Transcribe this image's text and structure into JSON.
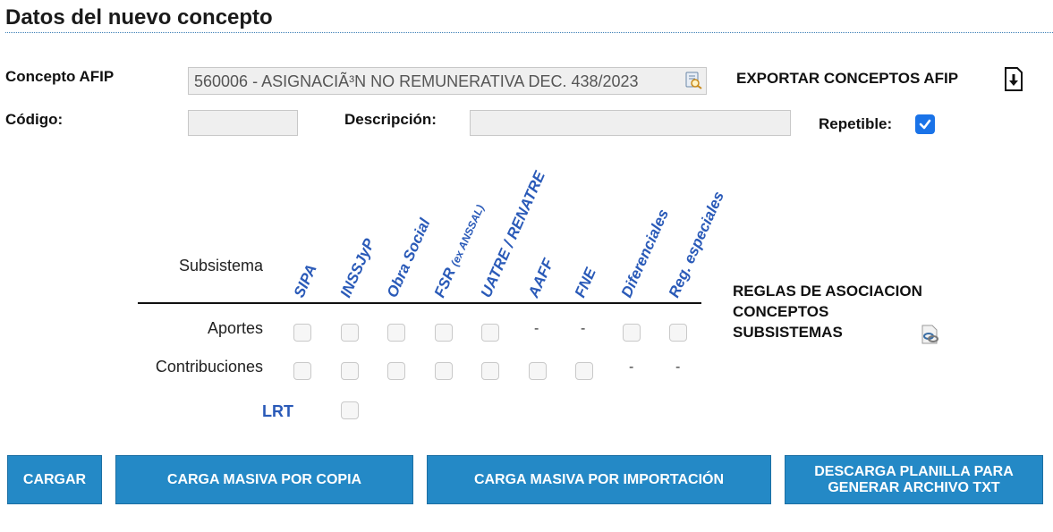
{
  "title": "Datos del nuevo concepto",
  "form": {
    "concepto_label": "Concepto AFIP",
    "concepto_value": "560006 - ASIGNACIÃ³N NO REMUNERATIVA DEC. 438/2023",
    "export_label": "EXPORTAR CONCEPTOS AFIP",
    "codigo_label": "Código:",
    "codigo_value": "",
    "descripcion_label": "Descripción:",
    "descripcion_value": "",
    "repetible_label": "Repetible:",
    "repetible_checked": true
  },
  "subsistemas": {
    "header_label": "Subsistema",
    "columns": [
      {
        "name": "SIPA",
        "sub": ""
      },
      {
        "name": "INSSJyP",
        "sub": ""
      },
      {
        "name": "Obra Social",
        "sub": ""
      },
      {
        "name": "FSR",
        "sub": "(ex ANSSAL)"
      },
      {
        "name": "UATRE / RENATRE",
        "sub": ""
      },
      {
        "name": "AAFF",
        "sub": ""
      },
      {
        "name": "FNE",
        "sub": ""
      },
      {
        "name": "Diferenciales",
        "sub": ""
      },
      {
        "name": "Reg. especiales",
        "sub": ""
      }
    ],
    "rows": [
      {
        "label": "Aportes",
        "cells": [
          "cb",
          "cb",
          "cb",
          "cb",
          "cb",
          "-",
          "-",
          "cb",
          "cb"
        ]
      },
      {
        "label": "Contribuciones",
        "cells": [
          "cb",
          "cb",
          "cb",
          "cb",
          "cb",
          "cb",
          "cb",
          "-",
          "-"
        ]
      }
    ],
    "lrt_label": "LRT",
    "reglas_lines": [
      "REGLAS DE ASOCIACION",
      "CONCEPTOS",
      "SUBSISTEMAS"
    ]
  },
  "buttons": {
    "cargar": "CARGAR",
    "copia": "CARGA MASIVA POR COPIA",
    "importacion": "CARGA MASIVA POR IMPORTACIÓN",
    "descarga_line1": "DESCARGA PLANILLA PARA",
    "descarga_line2": "GENERAR ARCHIVO TXT"
  },
  "colors": {
    "accent": "#2489c6",
    "checkbox": "#1a73e8",
    "header_text": "#2a5ab8"
  },
  "icons": {
    "afip_lookup": "search-doc-icon",
    "export": "download-icon",
    "reglas": "link-doc-icon",
    "repetible": "check-icon"
  }
}
